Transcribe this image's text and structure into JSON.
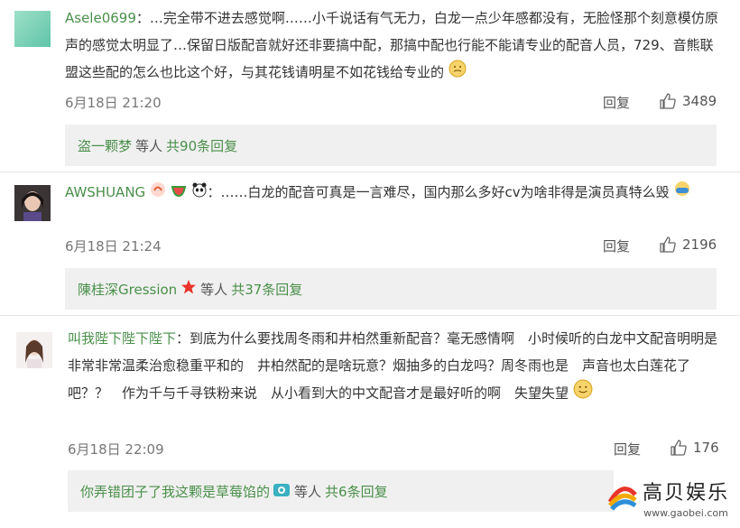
{
  "comments": [
    {
      "username": "Asele0699",
      "text": "：…完全带不进去感觉啊……小千说话有气无力，白龙一点少年感都没有，无脸怪那个刻意模仿原声的感觉太明显了…保留日版配音就好还非要搞中配，那搞中配也行能不能请专业的配音人员，729、音熊联盟这些配的怎么也比这个好，与其花钱请明星不如花钱给专业的",
      "time": "6月18日 21:20",
      "reply_label": "回复",
      "likes": "3489",
      "summary": {
        "user": "盗一颗梦",
        "mid": "等人",
        "count": "共90条回复"
      }
    },
    {
      "username": "AWSHUANG",
      "text": "：……白龙的配音可真是一言难尽，国内那么多好cv为啥非得是演员真特么毁",
      "time": "6月18日 21:24",
      "reply_label": "回复",
      "likes": "2196",
      "summary": {
        "user": "陳桂深Gression",
        "mid": "等人",
        "count": "共37条回复"
      }
    },
    {
      "username": "叫我陛下陛下陛下",
      "text": "：到底为什么要找周冬雨和井柏然重新配音？毫无感情啊　小时候听的白龙中文配音明明是非常非常温柔治愈稳重平和的　井柏然配的是啥玩意？烟抽多的白龙吗？周冬雨也是　声音也太白莲花了吧？？　作为千与千寻铁粉来说　从小看到大的中文配音才是最好听的啊　失望失望",
      "time": "6月18日 22:09",
      "reply_label": "回复",
      "likes": "176",
      "summary": {
        "user": "你弄错团子了我这颗是草莓馅的",
        "mid": "等人",
        "count": "共6条回复"
      }
    }
  ],
  "watermark": {
    "brand": "高贝娱乐",
    "url": "www.gaobei.com"
  },
  "colors": {
    "accent": "#4a8f4a",
    "summary_bg": "#f0f0f0",
    "divider": "#e6e6e6"
  }
}
